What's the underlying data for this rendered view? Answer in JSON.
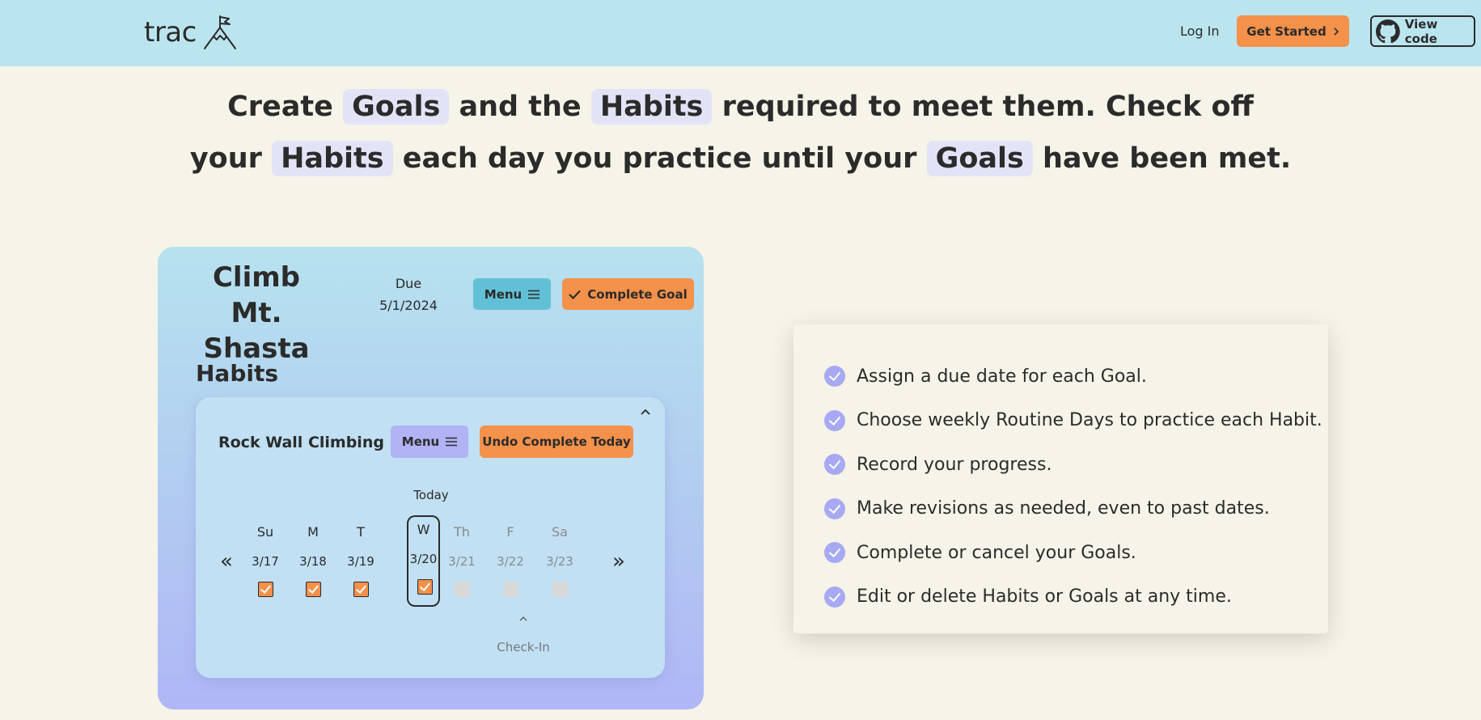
{
  "header": {
    "brand": "trac",
    "login_label": "Log In",
    "get_started_label": "Get Started",
    "view_code_label": "View code"
  },
  "headline": {
    "line1": {
      "a": "Create",
      "goals": "Goals",
      "b": "and the",
      "habits": "Habits",
      "c": "required to meet them. Check off"
    },
    "line2": {
      "a": "your",
      "habits": "Habits",
      "b": "each day you practice until your",
      "goals": "Goals",
      "c": "have been met."
    }
  },
  "goal": {
    "title": "Climb Mt. Shasta",
    "due_label": "Due",
    "due_date": "5/1/2024",
    "menu_label": "Menu",
    "complete_label": "Complete Goal",
    "habits_heading": "Habits"
  },
  "habit": {
    "name": "Rock Wall Climbing",
    "menu_label": "Menu",
    "undo_label": "Undo Complete Today",
    "today_label": "Today",
    "prev_icon": "«",
    "next_icon": "»",
    "days": [
      {
        "name": "Su",
        "date": "3/17",
        "checked": true
      },
      {
        "name": "M",
        "date": "3/18",
        "checked": true
      },
      {
        "name": "T",
        "date": "3/19",
        "checked": true
      },
      {
        "name": "W",
        "date": "3/20",
        "checked": true
      },
      {
        "name": "Th",
        "date": "3/21",
        "checked": false
      },
      {
        "name": "F",
        "date": "3/22",
        "checked": false
      },
      {
        "name": "Sa",
        "date": "3/23",
        "checked": false
      }
    ],
    "checkin_label": "Check-In"
  },
  "features": [
    "Assign a due date for each Goal.",
    "Choose weekly Routine Days to practice each Habit.",
    "Record your progress.",
    "Make revisions as needed, even to past dates.",
    "Complete or cancel your Goals.",
    "Edit or delete Habits or Goals at any time."
  ],
  "colors": {
    "header_bg": "#bbe5ee",
    "page_bg": "#f6f3e8",
    "accent_orange": "#f4914a",
    "menu_blue": "#62c0d6",
    "menu_purple": "#b1b3f5",
    "pill_bg": "#e3e3f7",
    "check_circle": "#a7a9f3"
  }
}
